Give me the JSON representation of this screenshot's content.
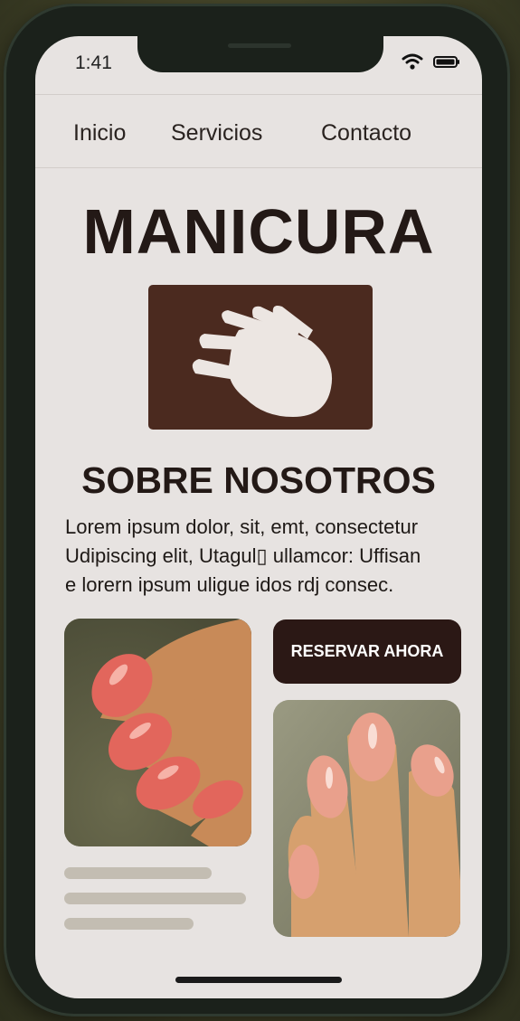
{
  "status_bar": {
    "time": "1:41"
  },
  "nav": {
    "items": [
      "Inicio",
      "Servicios",
      "Contacto"
    ]
  },
  "hero": {
    "title": "MANICURA",
    "icon": "hand-icon"
  },
  "about": {
    "title": "SOBRE NOSOTROS",
    "lines": [
      "Lorem ipsum dolor, sit, emt, consectetur",
      "Udipiscing elit, Utagul▯ ullamcor: Uffisan",
      "e lorern ipsum uligue idos rdj consec."
    ]
  },
  "cta": {
    "label": "RESERVAR AHORA"
  },
  "colors": {
    "accent": "#4b2a1f",
    "button": "#2b1815",
    "background": "#e7e3e1",
    "nail": "#e2665c"
  }
}
